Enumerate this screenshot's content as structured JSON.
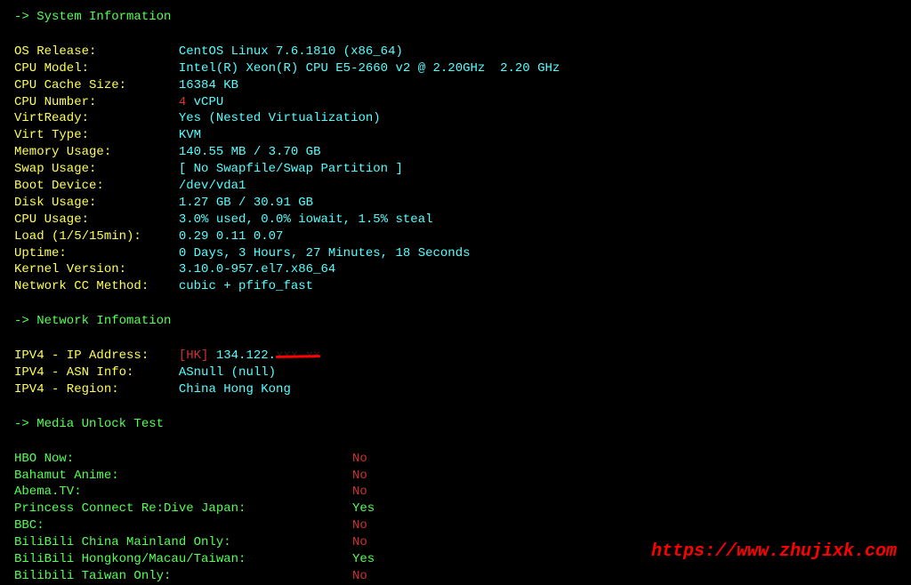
{
  "sections": {
    "sys": "-> System Information",
    "net": "-> Network Infomation",
    "media": "-> Media Unlock Test"
  },
  "sysinfo": {
    "os_release_label": "OS Release:",
    "os_release": "CentOS Linux 7.6.1810 (x86_64)",
    "cpu_model_label": "CPU Model:",
    "cpu_model": "Intel(R) Xeon(R) CPU E5-2660 v2 @ 2.20GHz  2.20 GHz",
    "cpu_cache_label": "CPU Cache Size:",
    "cpu_cache": "16384 KB",
    "cpu_num_label": "CPU Number:",
    "cpu_num_count": "4",
    "cpu_num_unit": " vCPU",
    "virtready_label": "VirtReady:",
    "virtready": "Yes (Nested Virtualization)",
    "virttype_label": "Virt Type:",
    "virttype": "KVM",
    "mem_label": "Memory Usage:",
    "mem": "140.55 MB / 3.70 GB",
    "swap_label": "Swap Usage:",
    "swap": "[ No Swapfile/Swap Partition ]",
    "boot_label": "Boot Device:",
    "boot": "/dev/vda1",
    "disk_label": "Disk Usage:",
    "disk": "1.27 GB / 30.91 GB",
    "cpuuse_label": "CPU Usage:",
    "cpuuse": "3.0% used, 0.0% iowait, 1.5% steal",
    "load_label": "Load (1/5/15min):",
    "load": "0.29 0.11 0.07",
    "uptime_label": "Uptime:",
    "uptime": "0 Days, 3 Hours, 27 Minutes, 18 Seconds",
    "kernel_label": "Kernel Version:",
    "kernel": "3.10.0-957.el7.x86_64",
    "cc_label": "Network CC Method:",
    "cc": "cubic + pfifo_fast"
  },
  "netinfo": {
    "ip_label": "IPV4 - IP Address:",
    "ip_tag": "[HK]",
    "ip_visible": " 134.122.",
    "ip_hidden": "xxx.xx",
    "asn_label": "IPV4 - ASN Info:",
    "asn": "ASnull (null)",
    "region_label": "IPV4 - Region:",
    "region": "China Hong Kong"
  },
  "media": [
    {
      "label": "HBO Now:",
      "value": "No",
      "pass": false
    },
    {
      "label": "Bahamut Anime:",
      "value": "No",
      "pass": false
    },
    {
      "label": "Abema.TV:",
      "value": "No",
      "pass": false
    },
    {
      "label": "Princess Connect Re:Dive Japan:",
      "value": "Yes",
      "pass": true
    },
    {
      "label": "BBC:",
      "value": "No",
      "pass": false
    },
    {
      "label": "BiliBili China Mainland Only:",
      "value": "No",
      "pass": false
    },
    {
      "label": "BiliBili Hongkong/Macau/Taiwan:",
      "value": "Yes",
      "pass": true
    },
    {
      "label": "Bilibili Taiwan Only:",
      "value": "No",
      "pass": false
    }
  ],
  "watermark": "https://www.zhujixk.com"
}
